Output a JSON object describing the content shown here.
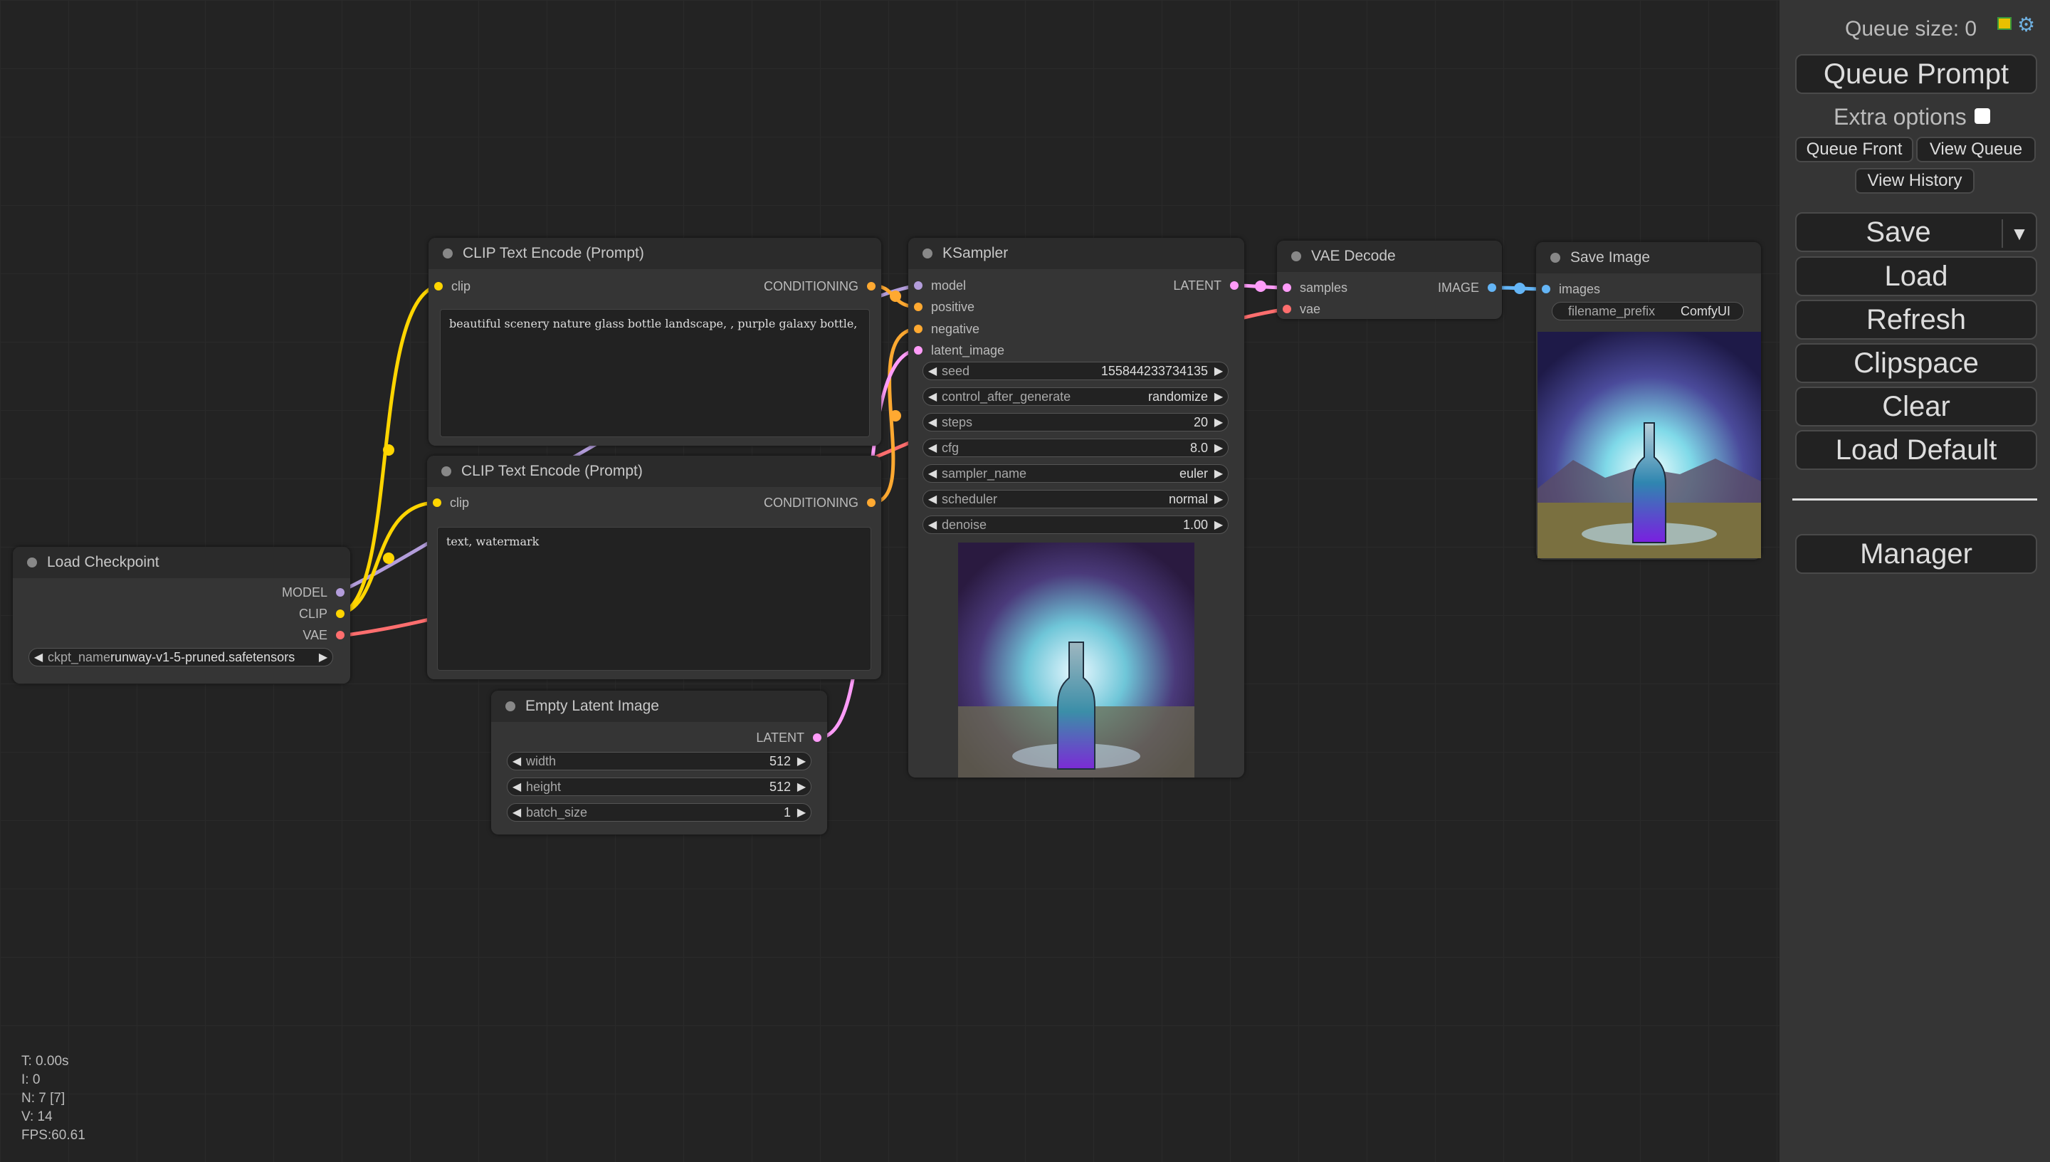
{
  "colors": {
    "canvas": "#232323",
    "node_bg": "#353535",
    "node_title": "#2b2b2b",
    "model": "#b39ddb",
    "clip": "#ffd500",
    "vae": "#ff6e6e",
    "conditioning": "#ffa931",
    "latent": "#ff9cf9",
    "image": "#64b5f6",
    "menu_bg": "#353535"
  },
  "nodes": {
    "clip_pos": {
      "title": "CLIP Text Encode (Prompt)",
      "input": "clip",
      "output": "CONDITIONING",
      "text": "beautiful scenery nature glass bottle landscape, , purple galaxy bottle,"
    },
    "clip_neg": {
      "title": "CLIP Text Encode (Prompt)",
      "input": "clip",
      "output": "CONDITIONING",
      "text": "text, watermark"
    },
    "checkpoint": {
      "title": "Load Checkpoint",
      "outputs": [
        "MODEL",
        "CLIP",
        "VAE"
      ],
      "widget": {
        "label": "ckpt_name",
        "value": "runway-v1-5-pruned.safetensors"
      }
    },
    "latent": {
      "title": "Empty Latent Image",
      "output": "LATENT",
      "widgets": [
        {
          "label": "width",
          "value": "512"
        },
        {
          "label": "height",
          "value": "512"
        },
        {
          "label": "batch_size",
          "value": "1"
        }
      ]
    },
    "ksampler": {
      "title": "KSampler",
      "inputs": [
        "model",
        "positive",
        "negative",
        "latent_image"
      ],
      "output": "LATENT",
      "widgets": [
        {
          "label": "seed",
          "value": "155844233734135"
        },
        {
          "label": "control_after_generate",
          "value": "randomize"
        },
        {
          "label": "steps",
          "value": "20"
        },
        {
          "label": "cfg",
          "value": "8.0"
        },
        {
          "label": "sampler_name",
          "value": "euler"
        },
        {
          "label": "scheduler",
          "value": "normal"
        },
        {
          "label": "denoise",
          "value": "1.00"
        }
      ]
    },
    "vae_decode": {
      "title": "VAE Decode",
      "inputs": [
        "samples",
        "vae"
      ],
      "output": "IMAGE"
    },
    "save_image": {
      "title": "Save Image",
      "input": "images",
      "widget": {
        "label": "filename_prefix",
        "value": "ComfyUI"
      }
    }
  },
  "menu": {
    "queue_size": "Queue size: 0",
    "queue_prompt": "Queue Prompt",
    "extra_options": "Extra options",
    "queue_front": "Queue Front",
    "view_queue": "View Queue",
    "view_history": "View History",
    "save": "Save",
    "save_dropdown": "▼",
    "load": "Load",
    "refresh": "Refresh",
    "clipspace": "Clipspace",
    "clear": "Clear",
    "load_default": "Load Default",
    "manager": "Manager"
  },
  "stats": {
    "t": "T: 0.00s",
    "i": "I: 0",
    "n": "N: 7 [7]",
    "v": "V: 14",
    "fps": "FPS:60.61"
  },
  "arrows": {
    "left": "◀",
    "right": "▶"
  }
}
